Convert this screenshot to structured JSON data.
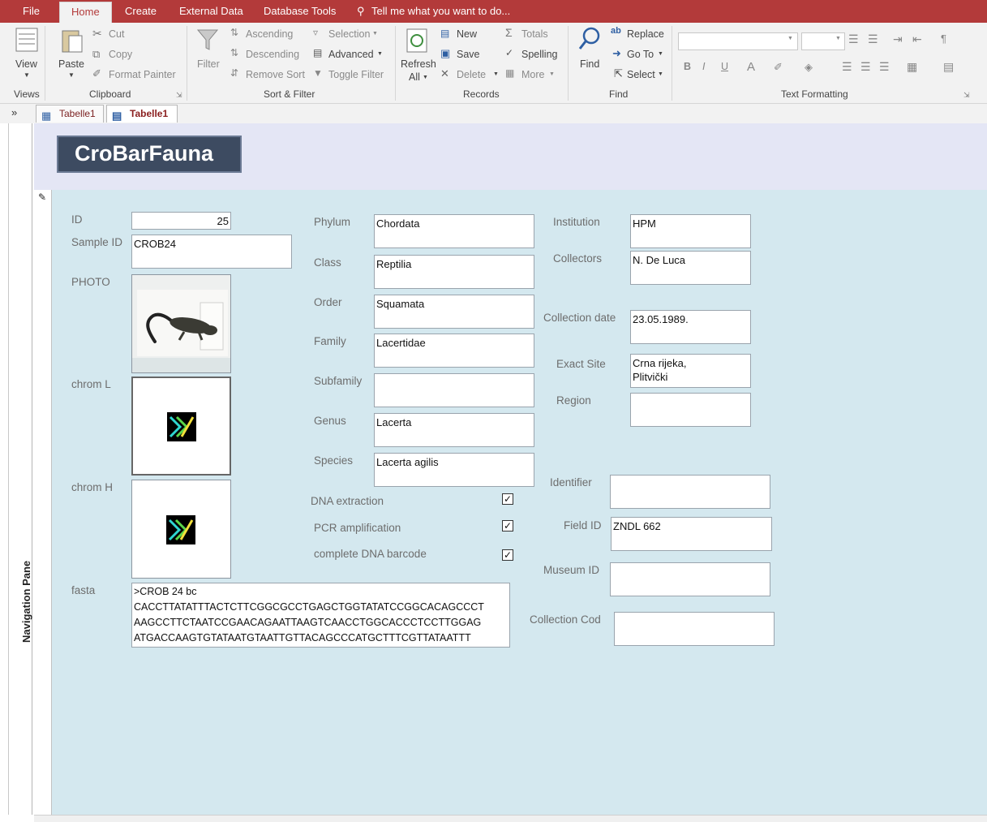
{
  "menu": {
    "file": "File",
    "home": "Home",
    "create": "Create",
    "external_data": "External Data",
    "database_tools": "Database Tools",
    "tell_me": "Tell me what you want to do..."
  },
  "ribbon": {
    "views": {
      "view": "View",
      "group": "Views"
    },
    "clipboard": {
      "paste": "Paste",
      "cut": "Cut",
      "copy": "Copy",
      "format_painter": "Format Painter",
      "group": "Clipboard"
    },
    "sort_filter": {
      "filter": "Filter",
      "ascending": "Ascending",
      "descending": "Descending",
      "remove_sort": "Remove Sort",
      "selection": "Selection",
      "advanced": "Advanced",
      "toggle_filter": "Toggle Filter",
      "group": "Sort & Filter"
    },
    "records": {
      "refresh": "Refresh",
      "refresh_all": "All",
      "new": "New",
      "save": "Save",
      "delete": "Delete",
      "totals": "Totals",
      "spelling": "Spelling",
      "more": "More",
      "group": "Records"
    },
    "find": {
      "find": "Find",
      "replace": "Replace",
      "go_to": "Go To",
      "select": "Select",
      "group": "Find"
    },
    "text_formatting": {
      "bold": "B",
      "italic": "I",
      "underline": "U",
      "font_color": "A",
      "group": "Text Formatting"
    }
  },
  "tabs": [
    {
      "label": "Tabelle1",
      "icon": "table-icon"
    },
    {
      "label": "Tabelle1",
      "icon": "form-icon"
    }
  ],
  "nav_pane": {
    "toggle": "»",
    "label": "Navigation Pane"
  },
  "form": {
    "title": "CroBarFauna",
    "col1": {
      "id_label": "ID",
      "id_value": "25",
      "sample_id_label": "Sample ID",
      "sample_id_value": "CROB24",
      "photo_label": "PHOTO",
      "chrom_l_label": "chrom L",
      "chrom_h_label": "chrom H",
      "fasta_label": "fasta",
      "fasta_lines": [
        ">CROB 24 bc",
        "CACCTTATATTTACTCTTCGGCGCCTGAGCTGGTATATCCGGCACAGCCCT",
        "AAGCCTTCTAATCCGAACAGAATTAAGTCAACCTGGCACCCTCCTTGGAG",
        "ATGACCAAGTGTATAATGTAATTGTTACAGCCCATGCTTTCGTTATAATTT"
      ]
    },
    "col2": {
      "phylum_label": "Phylum",
      "phylum_value": "Chordata",
      "class_label": "Class",
      "class_value": "Reptilia",
      "order_label": "Order",
      "order_value": "Squamata",
      "family_label": "Family",
      "family_value": "Lacertidae",
      "subfamily_label": "Subfamily",
      "subfamily_value": "",
      "genus_label": "Genus",
      "genus_value": "Lacerta",
      "species_label": "Species",
      "species_value": "Lacerta agilis",
      "dna_extraction_label": "DNA extraction",
      "pcr_label": "PCR amplification",
      "barcode_label": "complete DNA barcode",
      "dna_extraction_checked": true,
      "pcr_checked": true,
      "barcode_checked": true
    },
    "col3": {
      "institution_label": "Institution",
      "institution_value": "HPM",
      "collectors_label": "Collectors",
      "collectors_value": "N. De Luca",
      "collection_date_label": "Collection date",
      "collection_date_value": "23.05.1989.",
      "exact_site_label": "Exact Site",
      "exact_site_line1": "Crna rijeka,",
      "exact_site_line2": "Plitvički",
      "region_label": "Region",
      "region_value": "",
      "identifier_label": "Identifier",
      "identifier_value": "",
      "field_id_label": "Field ID",
      "field_id_value": "ZNDL 662",
      "museum_id_label": "Museum ID",
      "museum_id_value": "",
      "collection_code_label": "Collection Cod",
      "collection_code_value": ""
    }
  },
  "colors": {
    "menubar": "#b33a3a",
    "form_body": "#d4e8ef",
    "title_bg": "#3d4b61"
  }
}
